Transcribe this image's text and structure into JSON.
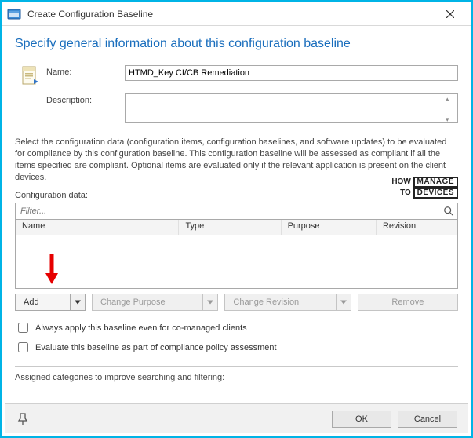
{
  "titlebar": {
    "title": "Create Configuration Baseline"
  },
  "heading": "Specify general information about this configuration baseline",
  "form": {
    "name_label": "Name:",
    "name_value": "HTMD_Key CI/CB Remediation",
    "description_label": "Description:",
    "description_value": ""
  },
  "help_text": "Select the configuration data (configuration items, configuration baselines, and software updates) to be evaluated for compliance by this configuration baseline. This configuration baseline will be assessed as compliant if all the items specified are compliant. Optional items are evaluated only if the relevant application is present on  the client devices.",
  "config": {
    "label": "Configuration data:",
    "filter_placeholder": "Filter...",
    "columns": {
      "name": "Name",
      "type": "Type",
      "purpose": "Purpose",
      "revision": "Revision"
    }
  },
  "buttons": {
    "add": "Add",
    "change_purpose": "Change Purpose",
    "change_revision": "Change Revision",
    "remove": "Remove"
  },
  "checkboxes": {
    "always_apply": "Always apply this baseline even for co-managed clients",
    "evaluate_compliance": "Evaluate this baseline as part of compliance policy assessment"
  },
  "categories_label": "Assigned categories to improve searching and filtering:",
  "footer": {
    "ok": "OK",
    "cancel": "Cancel"
  },
  "watermark": {
    "line1_prefix": "HOW",
    "line1_box": "MANAGE",
    "line2_prefix": "TO",
    "line2_box": "DEVICES"
  }
}
